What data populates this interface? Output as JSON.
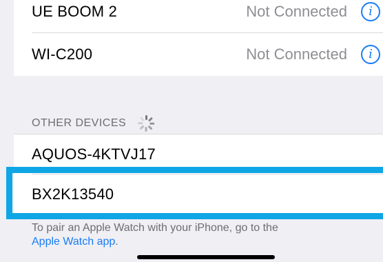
{
  "my_devices": [
    {
      "name": "UE BOOM 2",
      "status": "Not Connected",
      "info_glyph": "i"
    },
    {
      "name": "WI-C200",
      "status": "Not Connected",
      "info_glyph": "i"
    }
  ],
  "other_devices": {
    "header": "OTHER DEVICES",
    "items": [
      {
        "name": "AQUOS-4KTVJ17"
      },
      {
        "name": "BX2K13540"
      }
    ]
  },
  "footer": {
    "text": "To pair an Apple Watch with your iPhone, go to the",
    "link": "Apple Watch app",
    "suffix": "."
  },
  "colors": {
    "accent": "#1a7cf5",
    "highlight": "#10a6e6",
    "secondary_text": "#8e8e93",
    "background": "#efeff4"
  },
  "icons": {
    "info": "info-circle-icon",
    "spinner": "activity-spinner-icon"
  }
}
